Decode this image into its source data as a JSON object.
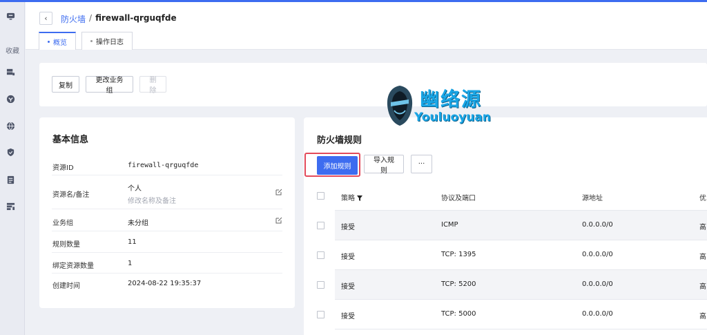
{
  "sidebar": {
    "favorites_label": "收藏"
  },
  "breadcrumb": {
    "parent": "防火墙",
    "separator": "/",
    "current": "firewall-qrguqfde"
  },
  "tabs": [
    {
      "label": "概览"
    },
    {
      "label": "操作日志"
    }
  ],
  "actions": {
    "copy": "复制",
    "change_group": "更改业务组",
    "delete": "删除"
  },
  "info": {
    "title": "基本信息",
    "rows": [
      {
        "label": "资源ID",
        "value": "firewall-qrguqfde"
      },
      {
        "label": "资源名/备注",
        "value": "个人",
        "sub": "修改名称及备注"
      },
      {
        "label": "业务组",
        "value": "未分组"
      },
      {
        "label": "规则数量",
        "value": "11"
      },
      {
        "label": "绑定资源数量",
        "value": "1"
      },
      {
        "label": "创建时间",
        "value": "2024-08-22 19:35:37"
      }
    ]
  },
  "rules": {
    "title": "防火墙规则",
    "add_button": "添加规则",
    "import_button": "导入规则",
    "more_button": "···",
    "columns": [
      "策略",
      "协议及端口",
      "源地址",
      "优"
    ],
    "rows": [
      [
        "接受",
        "ICMP",
        "0.0.0.0/0",
        "高"
      ],
      [
        "接受",
        "TCP: 1395",
        "0.0.0.0/0",
        "高"
      ],
      [
        "接受",
        "TCP: 5200",
        "0.0.0.0/0",
        "高"
      ],
      [
        "接受",
        "TCP: 5000",
        "0.0.0.0/0",
        "高"
      ]
    ]
  },
  "watermark": {
    "cn": "幽络源",
    "en": "Youluoyuan"
  },
  "colors": {
    "accent": "#3d6cf0",
    "highlight": "#e34a5b",
    "watermark": "#1aa6e6"
  }
}
